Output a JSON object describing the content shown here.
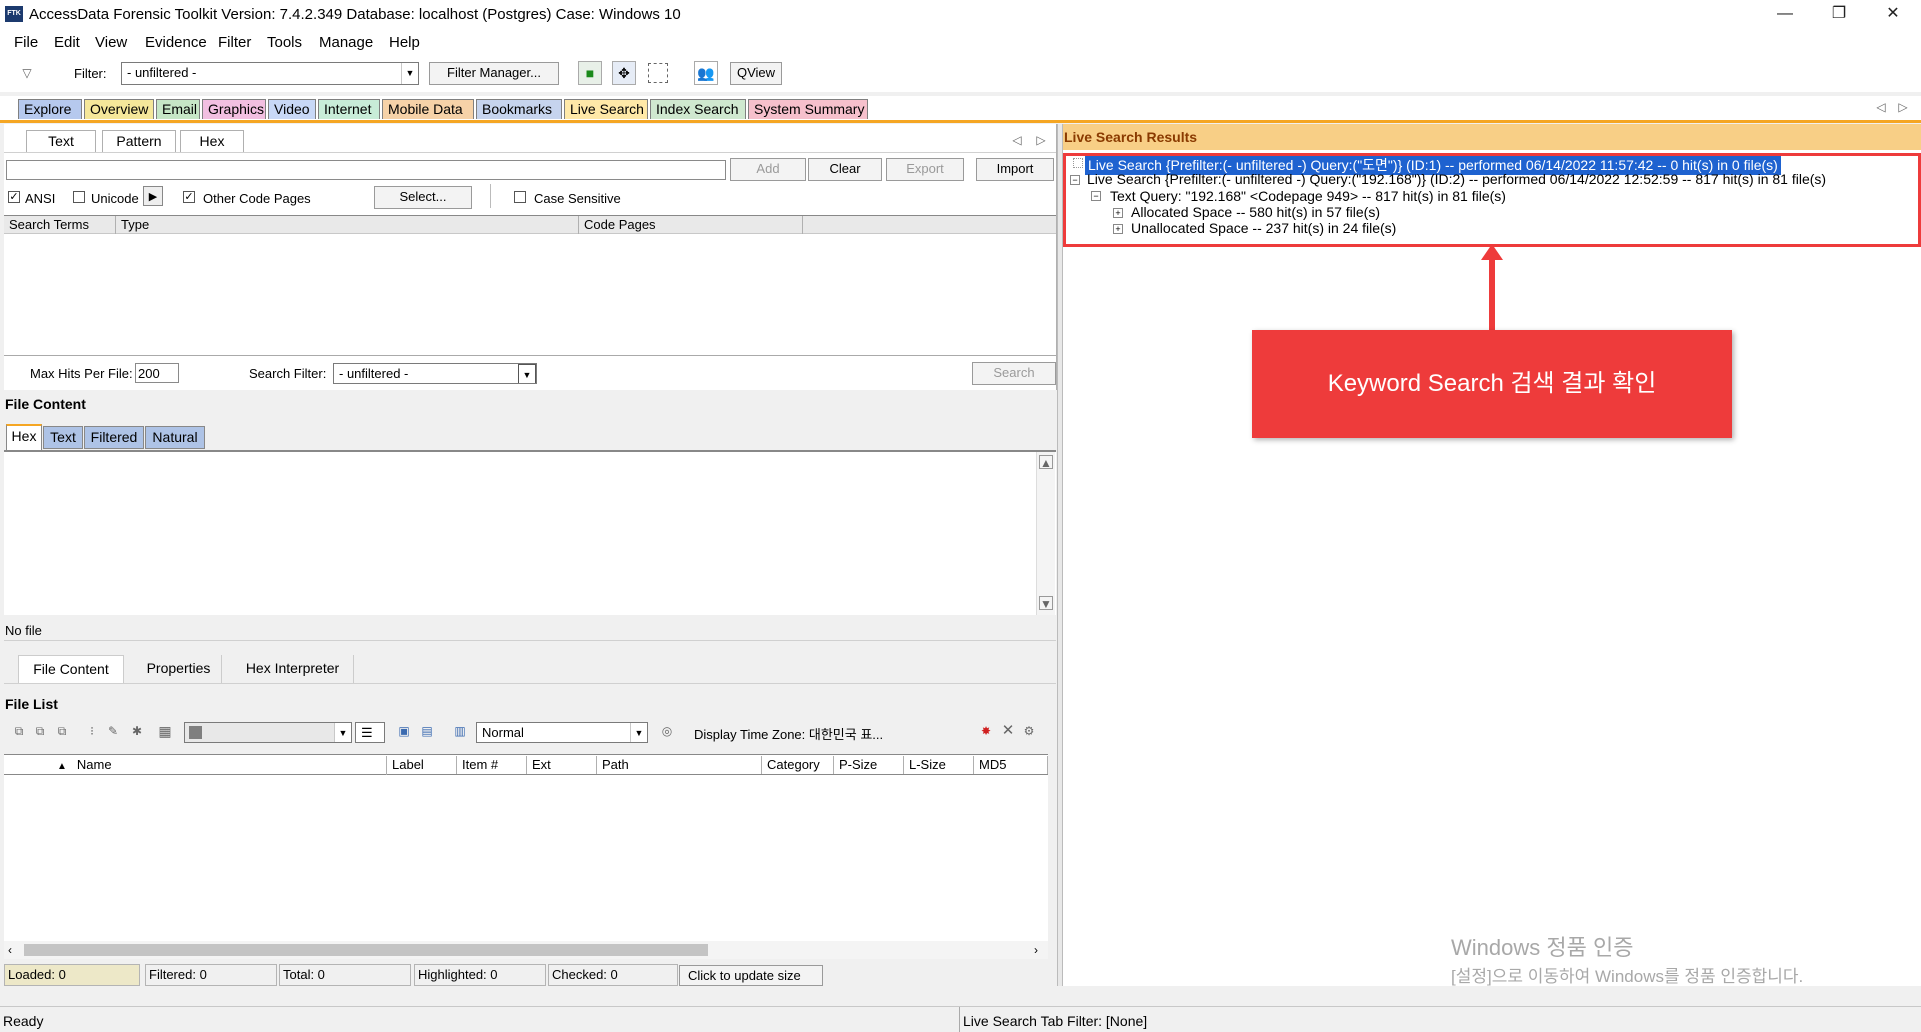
{
  "window": {
    "title": "AccessData Forensic Toolkit Version: 7.4.2.349 Database: localhost (Postgres) Case: Windows 10",
    "app_icon_text": "FTK",
    "minimize": "—",
    "restore": "❐",
    "close": "✕"
  },
  "menu": [
    "File",
    "Edit",
    "View",
    "Evidence",
    "Filter",
    "Tools",
    "Manage",
    "Help"
  ],
  "toolbar": {
    "filter_label": "Filter:",
    "filter_value": "- unfiltered -",
    "filter_manager": "Filter Manager...",
    "qview": "QView"
  },
  "main_tabs": [
    {
      "label": "Explore",
      "color": "#b6c9ee"
    },
    {
      "label": "Overview",
      "color": "#f5e79a"
    },
    {
      "label": "Email",
      "color": "#c6e6c6"
    },
    {
      "label": "Graphics",
      "color": "#f2bfe1"
    },
    {
      "label": "Video",
      "color": "#c8d8f6"
    },
    {
      "label": "Internet",
      "color": "#c8ecd8"
    },
    {
      "label": "Mobile Data",
      "color": "#f6d2a8"
    },
    {
      "label": "Bookmarks",
      "color": "#c6d4ee"
    },
    {
      "label": "Live Search",
      "color": "#ffe9a8"
    },
    {
      "label": "Index Search",
      "color": "#cfe8cf"
    },
    {
      "label": "System Summary",
      "color": "#f6c0cc"
    }
  ],
  "search_tabs": [
    "Text",
    "Pattern",
    "Hex"
  ],
  "search_buttons": {
    "add": "Add",
    "clear": "Clear",
    "export": "Export",
    "import": "Import"
  },
  "options": {
    "ansi": "ANSI",
    "unicode": "Unicode",
    "other_code_pages": "Other Code Pages",
    "select": "Select...",
    "case_sensitive": "Case Sensitive"
  },
  "terms_columns": [
    "Search Terms",
    "Type",
    "Code Pages"
  ],
  "search_bottom": {
    "max_hits_label": "Max Hits Per File:",
    "max_hits_value": "200",
    "search_filter_label": "Search Filter:",
    "search_filter_value": "- unfiltered -",
    "search_button": "Search"
  },
  "file_content": {
    "title": "File Content",
    "tabs": [
      "Hex",
      "Text",
      "Filtered",
      "Natural"
    ],
    "status": "No file",
    "bottom_tabs": [
      "File Content",
      "Properties",
      "Hex Interpreter"
    ]
  },
  "file_list": {
    "title": "File List",
    "view_value": "Normal",
    "timezone_label": "Display Time Zone: 대한민국 표...",
    "columns": [
      "Name",
      "Label",
      "Item #",
      "Ext",
      "Path",
      "Category",
      "P-Size",
      "L-Size",
      "MD5"
    ],
    "status": [
      "Loaded: 0",
      "Filtered: 0",
      "Total: 0",
      "Highlighted: 0",
      "Checked: 0"
    ],
    "update_button": "Click to update size"
  },
  "results": {
    "title": "Live Search Results",
    "lines": [
      "Live Search {Prefilter:(- unfiltered -) Query:(\"도면\")} (ID:1) -- performed 06/14/2022 11:57:42 -- 0 hit(s) in 0 file(s)",
      "Live Search {Prefilter:(- unfiltered -) Query:(\"192.168\")} (ID:2) -- performed 06/14/2022 12:52:59 -- 817 hit(s) in 81 file(s)",
      "Text Query: \"192.168\" <Codepage 949> -- 817 hit(s) in 81 file(s)",
      "Allocated Space -- 580 hit(s) in 57 file(s)",
      "Unallocated Space -- 237 hit(s) in 24 file(s)"
    ]
  },
  "annotation": {
    "text": "Keyword Search 검색 결과 확인",
    "color": "#ee3b3b"
  },
  "watermark": {
    "line1": "Windows 정품 인증",
    "line2": "[설정]으로 이동하여 Windows를 정품 인증합니다."
  },
  "statusbar": {
    "left": "Ready",
    "right": "Live Search Tab Filter: [None]"
  }
}
